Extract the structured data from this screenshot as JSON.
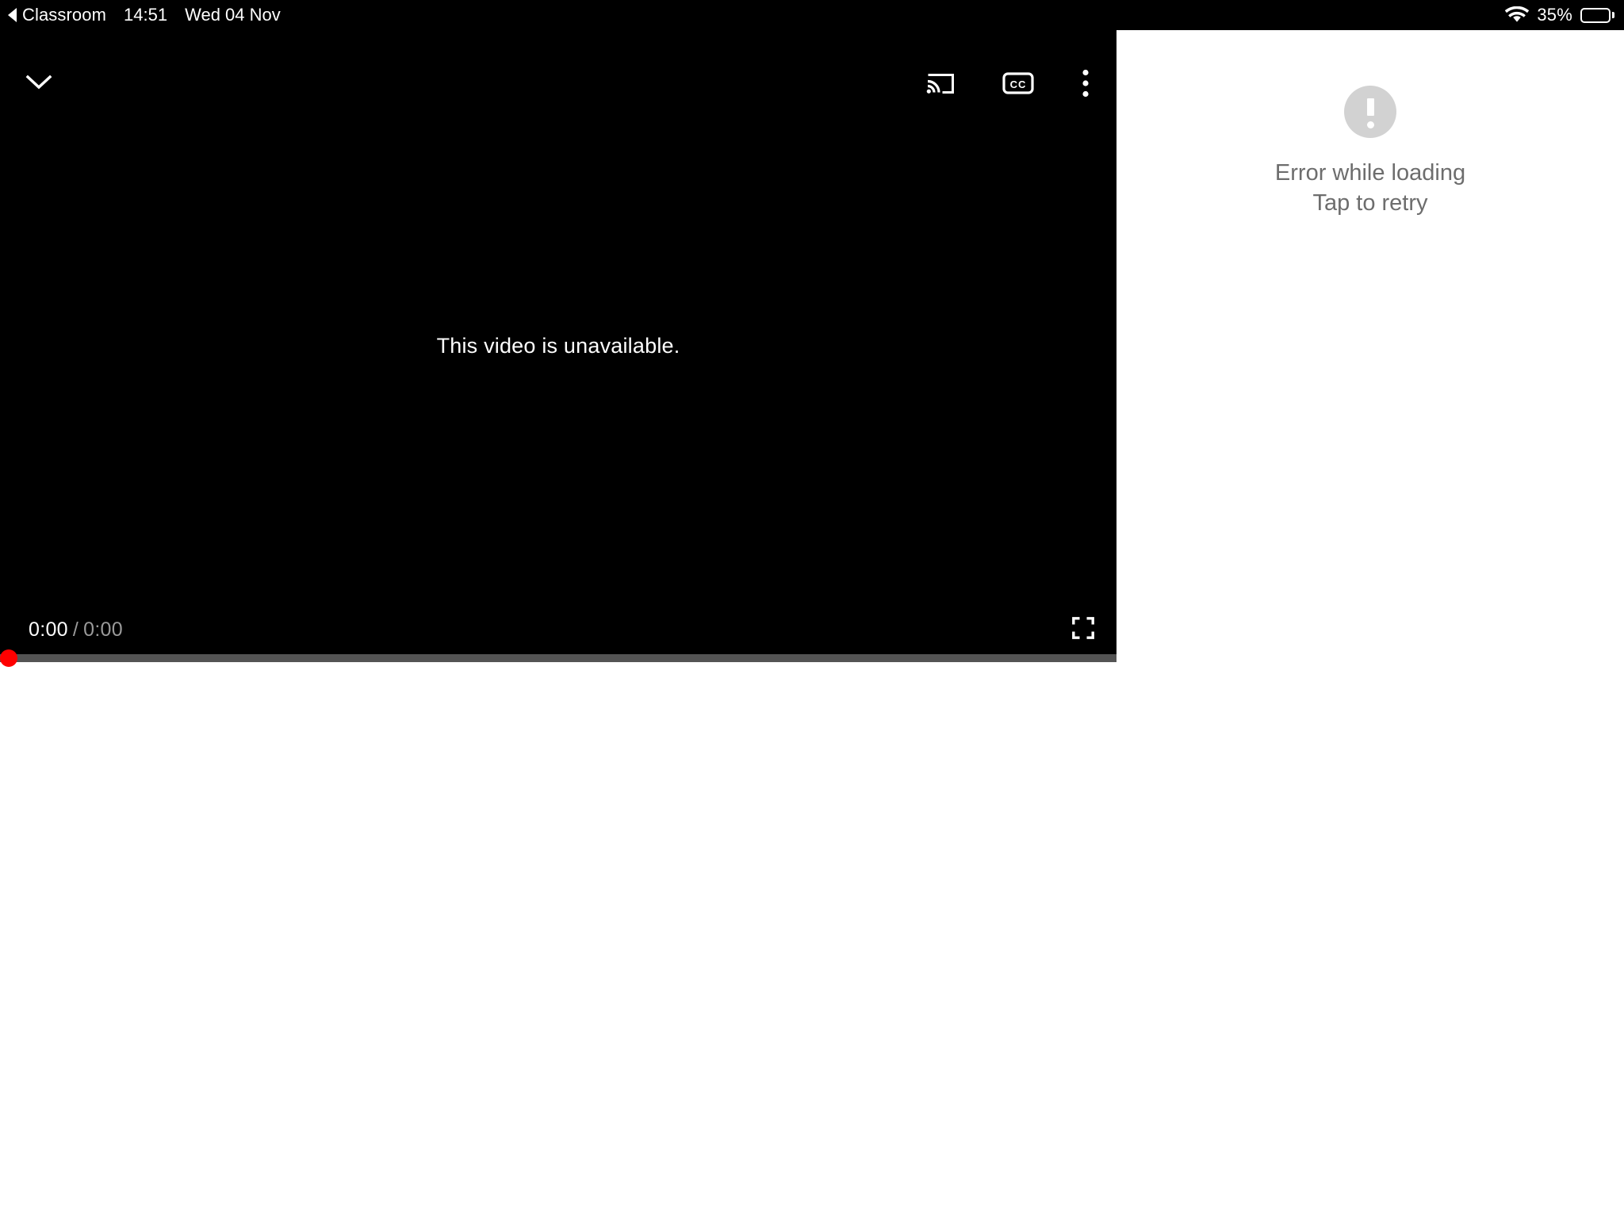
{
  "status_bar": {
    "back_icon": "back-triangle-icon",
    "app_name": "Classroom",
    "time": "14:51",
    "date": "Wed 04 Nov",
    "wifi_icon": "wifi-icon",
    "battery_percent": "35%",
    "battery_level": 35
  },
  "video_player": {
    "collapse_icon": "chevron-down-icon",
    "cast_icon": "cast-icon",
    "captions_icon": "closed-captions-icon",
    "overflow_icon": "more-vertical-icon",
    "message": "This video is unavailable.",
    "current_time": "0:00",
    "time_separator": "/",
    "total_time": "0:00",
    "fullscreen_icon": "fullscreen-icon",
    "progress_percent": 0,
    "accent_color": "#ff0000",
    "track_color": "#545454"
  },
  "error_panel": {
    "icon": "error-exclamation-icon",
    "icon_color": "#d2d2d2",
    "line1": "Error while loading",
    "line2": "Tap to retry",
    "text_color": "#6d6d6d"
  }
}
